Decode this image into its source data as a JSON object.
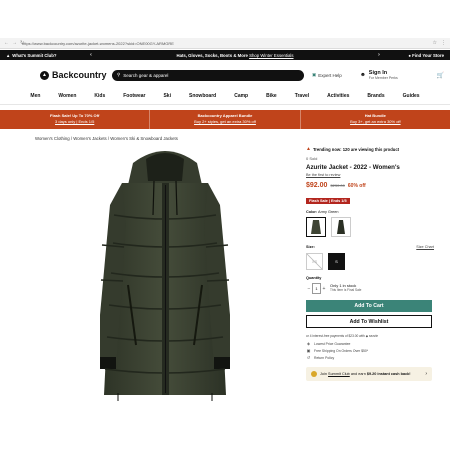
{
  "browser": {
    "url": "https://www.backcountry.com/azurite-jacket-womens-2022?skid=ONE00GY-ARMGRE",
    "back_icon": "arrow-left-icon",
    "forward_icon": "arrow-right-icon",
    "reload_icon": "reload-icon"
  },
  "promo": {
    "club_label": "What's Summit Club?",
    "message": "Hats, Gloves, Socks, Boots & More",
    "message_link": "Shop Winter Essentials",
    "store_label": "Find Your Store"
  },
  "header": {
    "logo": "Backcountry",
    "search_placeholder": "Search gear & apparel",
    "expert_help": "Expert Help",
    "signin": "Sign In",
    "signin_sub": "For Member Perks",
    "cart_icon": "cart-icon"
  },
  "categories": [
    "Men",
    "Women",
    "Kids",
    "Footwear",
    "Ski",
    "Snowboard",
    "Camp",
    "Bike",
    "Travel",
    "Activities",
    "Brands",
    "Guides"
  ],
  "deals": [
    {
      "title": "Flash Sale! Up To 70% Off",
      "sub": "3 days only | Ends 1/5"
    },
    {
      "title": "Backcountry Apparel Bundle",
      "sub": "Buy 2+ styles, get an extra 30% off"
    },
    {
      "title": "Hat Bundle",
      "sub": "Buy 3+, get an extra 30% off"
    }
  ],
  "breadcrumb": "Women's Clothing / Women's Jackets / Women's Ski & Snowboard Jackets",
  "product": {
    "trending": "Trending now: 120 are viewing this product",
    "sold": "0 Sold",
    "title": "Azurite Jacket - 2022 - Women's",
    "review_link": "Be the first to review",
    "price_now": "$92.00",
    "price_was": "$230.00",
    "price_off": "60% off",
    "flash_badge": "Flash Sale | Ends 1/5",
    "color_label": "Color:",
    "color_value": "Army Green",
    "size_label": "Size:",
    "size_guide": "Size Chart",
    "sizes": [
      {
        "label": "XS",
        "state": "unavailable"
      },
      {
        "label": "S",
        "state": "selected"
      }
    ],
    "qty_label": "Quantity",
    "qty_value": "1",
    "stock": "Only 1 in stock",
    "stock_sub": "This Item is Final Sale",
    "add_to_cart": "Add To Cart",
    "add_to_wishlist": "Add To Wishlist",
    "payments": "or 4 interest-free payments of $23.00 with ◆ sezzle",
    "perks": [
      {
        "icon": "shield-icon",
        "text": "Lowest Price Guarantee"
      },
      {
        "icon": "truck-icon",
        "text": "Free Shipping On Orders Over $50*"
      },
      {
        "icon": "return-icon",
        "text": "Return Policy"
      }
    ],
    "club_offer_a": "Join ",
    "club_offer_link": "Summit Club",
    "club_offer_b": " and earn ",
    "club_offer_bold": "$9.20 instant cash back!",
    "colors": {
      "accent": "#c0441b",
      "cart": "#3b8478",
      "jacket": "#3e4434"
    }
  }
}
